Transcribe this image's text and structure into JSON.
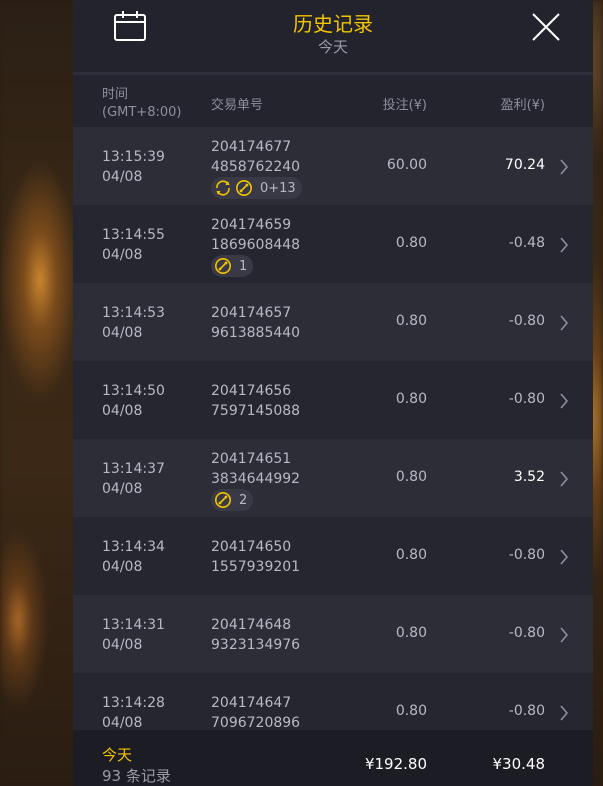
{
  "header": {
    "title": "历史记录",
    "subtitle": "今天"
  },
  "columns": {
    "time_label": "时间",
    "time_zone": "(GMT+8:00)",
    "order_label": "交易单号",
    "bet_label": "投注(¥)",
    "profit_label": "盈利(¥)"
  },
  "rows": [
    {
      "time": "13:15:39",
      "date": "04/08",
      "order_line1": "204174677",
      "order_line2": "4858762240",
      "bet": "60.00",
      "profit": "70.24",
      "profit_positive": true,
      "tags": [
        {
          "icons": [
            "refresh",
            "bonus"
          ],
          "text": "0+13"
        }
      ]
    },
    {
      "time": "13:14:55",
      "date": "04/08",
      "order_line1": "204174659",
      "order_line2": "1869608448",
      "bet": "0.80",
      "profit": "-0.48",
      "profit_positive": false,
      "tags": [
        {
          "icons": [
            "bonus"
          ],
          "text": "1"
        }
      ]
    },
    {
      "time": "13:14:53",
      "date": "04/08",
      "order_line1": "204174657",
      "order_line2": "9613885440",
      "bet": "0.80",
      "profit": "-0.80",
      "profit_positive": false,
      "tags": []
    },
    {
      "time": "13:14:50",
      "date": "04/08",
      "order_line1": "204174656",
      "order_line2": "7597145088",
      "bet": "0.80",
      "profit": "-0.80",
      "profit_positive": false,
      "tags": []
    },
    {
      "time": "13:14:37",
      "date": "04/08",
      "order_line1": "204174651",
      "order_line2": "3834644992",
      "bet": "0.80",
      "profit": "3.52",
      "profit_positive": true,
      "tags": [
        {
          "icons": [
            "bonus"
          ],
          "text": "2"
        }
      ]
    },
    {
      "time": "13:14:34",
      "date": "04/08",
      "order_line1": "204174650",
      "order_line2": "1557939201",
      "bet": "0.80",
      "profit": "-0.80",
      "profit_positive": false,
      "tags": []
    },
    {
      "time": "13:14:31",
      "date": "04/08",
      "order_line1": "204174648",
      "order_line2": "9323134976",
      "bet": "0.80",
      "profit": "-0.80",
      "profit_positive": false,
      "tags": []
    },
    {
      "time": "13:14:28",
      "date": "04/08",
      "order_line1": "204174647",
      "order_line2": "7096720896",
      "bet": "0.80",
      "profit": "-0.80",
      "profit_positive": false,
      "tags": []
    }
  ],
  "footer": {
    "label": "今天",
    "count": "93 条记录",
    "total_bet": "¥192.80",
    "total_profit": "¥30.48"
  },
  "colors": {
    "accent": "#f3c400",
    "text_muted": "#b9b9c4",
    "text_positive": "#ffffff"
  }
}
